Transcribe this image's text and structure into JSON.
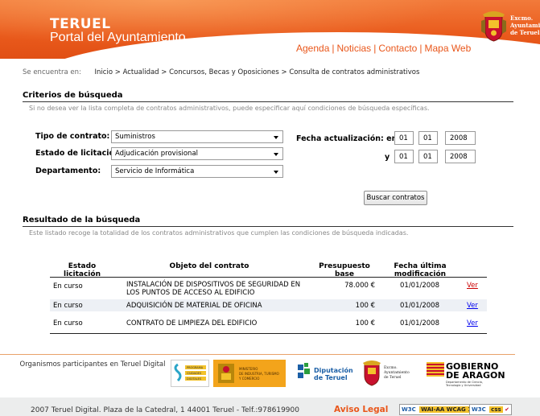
{
  "header": {
    "brand_top": "TERUEL",
    "brand_bottom": "Portal del Ayuntamiento",
    "nav": [
      "Agenda",
      "Noticias",
      "Contacto",
      "Mapa Web"
    ],
    "seal_text": [
      "Excmo.",
      "Ayuntamiento",
      "de Teruel"
    ]
  },
  "breadcrumb": {
    "label": "Se encuentra en:",
    "items": [
      "Inicio",
      "Actualidad",
      "Concursos, Becas y Oposiciones",
      "Consulta de contratos administrativos"
    ],
    "separator": ">"
  },
  "search": {
    "title": "Criterios de búsqueda",
    "description": "Si no desea ver la lista completa de contratos administrativos, puede especificar aquí condiciones de búsqueda específicas.",
    "tipo_label": "Tipo de contrato:",
    "tipo_value": "Suministros",
    "estado_label": "Estado de licitación:",
    "estado_value": "Adjudicación provisional",
    "depto_label": "Departamento:",
    "depto_value": "Servicio de Informática",
    "fecha_label": "Fecha actualización: entre",
    "and_label": "y",
    "from": {
      "day": "01",
      "month": "01",
      "year": "2008"
    },
    "to": {
      "day": "01",
      "month": "01",
      "year": "2008"
    },
    "button": "Buscar contratos"
  },
  "results": {
    "title": "Resultado de la búsqueda",
    "description": "Este listado recoge la totalidad de los contratos administrativos que cumplen las condiciones de búsqueda indicadas.",
    "headers": {
      "estado": "Estado licitación",
      "objeto": "Objeto del contrato",
      "presupuesto_1": "Presupuesto",
      "presupuesto_2": "base",
      "fecha_1": "Fecha última",
      "fecha_2": "modificación"
    },
    "rows": [
      {
        "estado": "En curso",
        "objeto_1": "INSTALACIÓN DE DISPOSITIVOS DE SEGURIDAD EN",
        "objeto_2": "LOS PUNTOS DE ACCESO AL EDIFICIO",
        "presupuesto": "78.000 €",
        "fecha": "01/01/2008",
        "link": "Ver"
      },
      {
        "estado": "En curso",
        "objeto_1": "ADQUISICIÓN DE MATERIAL DE OFICINA",
        "objeto_2": "",
        "presupuesto": "100 €",
        "fecha": "01/01/2008",
        "link": "Ver"
      },
      {
        "estado": "En curso",
        "objeto_1": "CONTRATO DE LIMPIEZA DEL EDIFICIO",
        "objeto_2": "",
        "presupuesto": "100 €",
        "fecha": "01/01/2008",
        "link": "Ver"
      }
    ]
  },
  "footer": {
    "organisms_label": "Organismos participantes en Teruel Digital",
    "logos": {
      "programa": [
        "PROGRAMA",
        "CIUDADES",
        "DIGITALES"
      ],
      "ministerio": [
        "MINISTERIO",
        "DE INDUSTRIA, TURISMO",
        "Y COMERCIO"
      ],
      "diputacion": [
        "Diputación",
        "de Teruel"
      ],
      "ayto": [
        "Excmo.",
        "Ayuntamiento",
        "de Teruel"
      ],
      "gobierno": [
        "GOBIERNO",
        "DE ARAGON",
        "Departamento de Ciencia,",
        "Tecnología y Universidad"
      ]
    },
    "address": "2007 Teruel Digital. Plaza de la Catedral, 1 44001 Teruel - Telf.:978619900",
    "legal": "Aviso Legal",
    "badge_wai_1": "W3C",
    "badge_wai_2": "WAI-AA",
    "badge_wai_3": "WCAG 1.0",
    "badge_css_1": "W3C",
    "badge_css_2": "css"
  }
}
